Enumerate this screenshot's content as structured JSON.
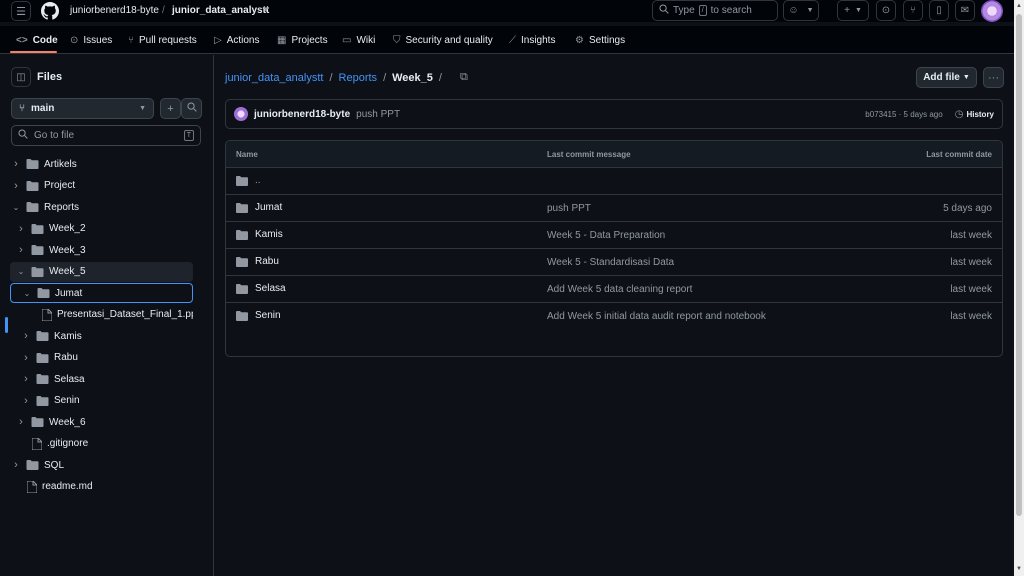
{
  "header": {
    "owner": "juniorbenerd18-byte",
    "separator": "/",
    "repo": "junior_data_analystt",
    "search_placeholder": "Type / to search",
    "search_prefix": "Type",
    "search_key": "/",
    "search_suffix": "to search"
  },
  "tabs": [
    {
      "label": "Code",
      "icon": "code-icon",
      "active": true
    },
    {
      "label": "Issues",
      "icon": "issue-icon"
    },
    {
      "label": "Pull requests",
      "icon": "pull-request-icon"
    },
    {
      "label": "Actions",
      "icon": "play-icon"
    },
    {
      "label": "Projects",
      "icon": "table-icon"
    },
    {
      "label": "Wiki",
      "icon": "book-icon"
    },
    {
      "label": "Security and quality",
      "icon": "shield-icon"
    },
    {
      "label": "Insights",
      "icon": "graph-icon"
    },
    {
      "label": "Settings",
      "icon": "gear-icon"
    }
  ],
  "sidebar": {
    "title": "Files",
    "branch": "main",
    "goto_placeholder": "Go to file",
    "goto_key": "T",
    "tree": [
      {
        "label": "Artikels",
        "type": "folder",
        "depth": 0,
        "expanded": false
      },
      {
        "label": "Project",
        "type": "folder",
        "depth": 0,
        "expanded": false
      },
      {
        "label": "Reports",
        "type": "folder",
        "depth": 0,
        "expanded": true
      },
      {
        "label": "Week_2",
        "type": "folder",
        "depth": 1,
        "expanded": false
      },
      {
        "label": "Week_3",
        "type": "folder",
        "depth": 1,
        "expanded": false
      },
      {
        "label": "Week_5",
        "type": "folder",
        "depth": 1,
        "expanded": true,
        "current": true
      },
      {
        "label": "Jumat",
        "type": "folder",
        "depth": 2,
        "expanded": true,
        "selected": true
      },
      {
        "label": "Presentasi_Dataset_Final_1.pp...",
        "type": "file",
        "depth": 3
      },
      {
        "label": "Kamis",
        "type": "folder",
        "depth": 2,
        "expanded": false
      },
      {
        "label": "Rabu",
        "type": "folder",
        "depth": 2,
        "expanded": false
      },
      {
        "label": "Selasa",
        "type": "folder",
        "depth": 2,
        "expanded": false
      },
      {
        "label": "Senin",
        "type": "folder",
        "depth": 2,
        "expanded": false
      },
      {
        "label": "Week_6",
        "type": "folder",
        "depth": 1,
        "expanded": false
      },
      {
        "label": ".gitignore",
        "type": "file",
        "depth": 1
      },
      {
        "label": "SQL",
        "type": "folder",
        "depth": 0,
        "expanded": false
      },
      {
        "label": "readme.md",
        "type": "file",
        "depth": 0
      }
    ]
  },
  "main": {
    "breadcrumb": [
      "junior_data_analystt",
      "Reports",
      "Week_5"
    ],
    "add_file_label": "Add file",
    "commit": {
      "author": "juniorbenerd18-byte",
      "message": "push PPT",
      "hash_age": "b073415 · 5 days ago",
      "history_label": "History"
    },
    "columns": [
      "Name",
      "Last commit message",
      "Last commit date"
    ],
    "parent_dir": "..",
    "rows": [
      {
        "name": "Jumat",
        "message": "push PPT",
        "date": "5 days ago"
      },
      {
        "name": "Kamis",
        "message": "Week 5 - Data Preparation",
        "date": "last week"
      },
      {
        "name": "Rabu",
        "message": "Week 5 - Standardisasi Data",
        "date": "last week"
      },
      {
        "name": "Selasa",
        "message": "Add Week 5 data cleaning report",
        "date": "last week"
      },
      {
        "name": "Senin",
        "message": "Add Week 5 initial data audit report and notebook",
        "date": "last week"
      }
    ]
  },
  "colors": {
    "background": "#0d1117",
    "link": "#4493f8",
    "muted": "#9198a1",
    "folder": "#9198a1",
    "border": "#30363d",
    "active_tab_underline": "#f78166"
  }
}
